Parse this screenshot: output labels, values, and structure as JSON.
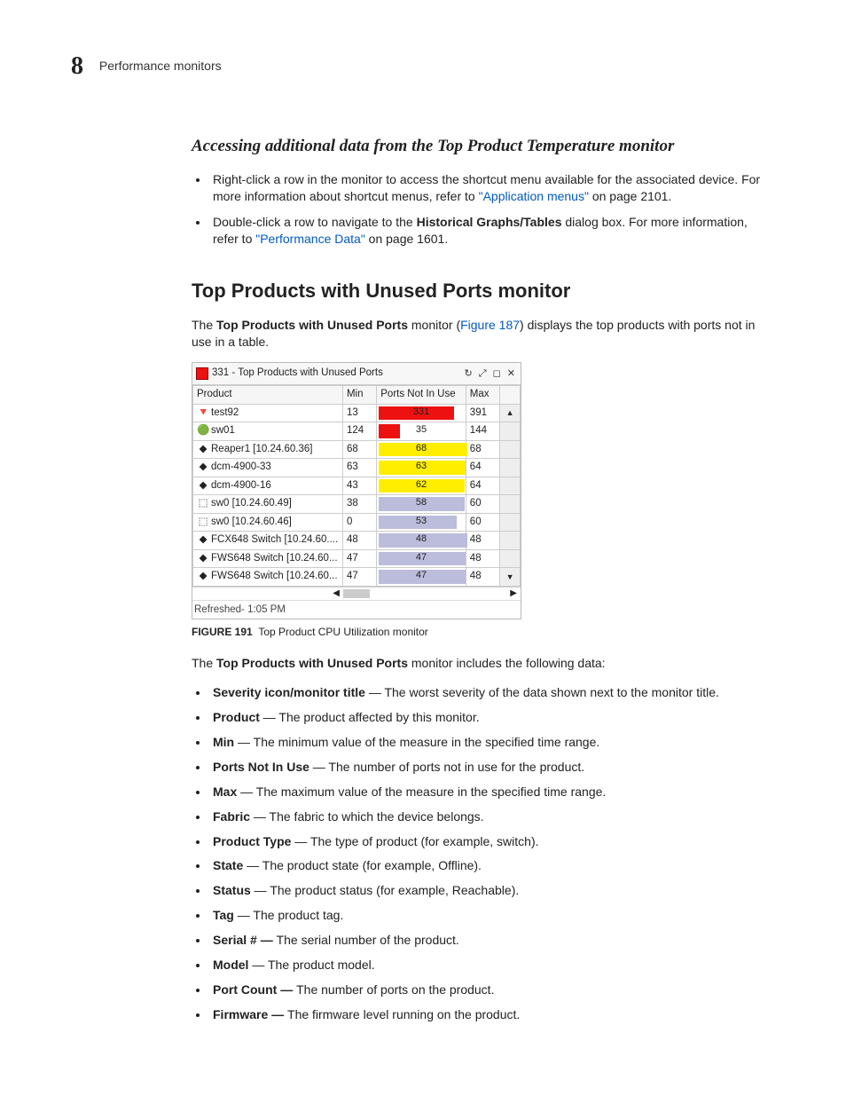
{
  "header": {
    "chapter": "8",
    "section": "Performance monitors"
  },
  "sub1": {
    "title": "Accessing additional data from the Top Product Temperature monitor",
    "bullets": [
      {
        "pre": "Right-click a row in the monitor to access the shortcut menu available for the associated device. For more information about shortcut menus, refer to ",
        "link": "\"Application menus\"",
        "post": " on page 2101."
      },
      {
        "pre": "Double-click a row to navigate to the ",
        "bold": "Historical Graphs/Tables",
        "mid": " dialog box. For more information, refer to ",
        "link": "\"Performance Data\"",
        "post": " on page 1601."
      }
    ]
  },
  "section2": {
    "title": "Top Products with Unused Ports monitor",
    "intro_pre": "The ",
    "intro_bold": "Top Products with Unused Ports",
    "intro_mid": " monitor (",
    "intro_link": "Figure 187",
    "intro_post": ") displays the top products with ports not in use in a table."
  },
  "figure": {
    "title": "331 - Top Products with Unused Ports",
    "columns": [
      "Product",
      "Min",
      "Ports Not In Use",
      "Max"
    ],
    "refreshed": "Refreshed- 1:05 PM",
    "caption_label": "FIGURE 191",
    "caption_text": "Top Product CPU Utilization monitor"
  },
  "chart_data": {
    "type": "table",
    "rows": [
      {
        "product": "test92",
        "min": 13,
        "ports": 331,
        "max": 391,
        "color": "#e11",
        "pct": 85,
        "icon": "🔻"
      },
      {
        "product": "sw01",
        "min": 124,
        "ports": 35,
        "max": 144,
        "color": "#e11",
        "pct": 24,
        "icon": "🟢"
      },
      {
        "product": "Reaper1 [10.24.60.36]",
        "min": 68,
        "ports": 68,
        "max": 68,
        "color": "#fe0",
        "pct": 100,
        "icon": "◆"
      },
      {
        "product": "dcm-4900-33",
        "min": 63,
        "ports": 63,
        "max": 64,
        "color": "#fe0",
        "pct": 98,
        "icon": "◆"
      },
      {
        "product": "dcm-4900-16",
        "min": 43,
        "ports": 62,
        "max": 64,
        "color": "#fe0",
        "pct": 97,
        "icon": "◆"
      },
      {
        "product": "sw0 [10.24.60.49]",
        "min": 38,
        "ports": 58,
        "max": 60,
        "color": "#bcbcdc",
        "pct": 97,
        "icon": "⬚"
      },
      {
        "product": "sw0 [10.24.60.46]",
        "min": 0,
        "ports": 53,
        "max": 60,
        "color": "#bcbcdc",
        "pct": 88,
        "icon": "⬚"
      },
      {
        "product": "FCX648 Switch [10.24.60....",
        "min": 48,
        "ports": 48,
        "max": 48,
        "color": "#bcbcdc",
        "pct": 100,
        "icon": "◆"
      },
      {
        "product": "FWS648 Switch [10.24.60...",
        "min": 47,
        "ports": 47,
        "max": 48,
        "color": "#bcbcdc",
        "pct": 98,
        "icon": "◆"
      },
      {
        "product": "FWS648 Switch [10.24.60...",
        "min": 47,
        "ports": 47,
        "max": 48,
        "color": "#bcbcdc",
        "pct": 98,
        "icon": "◆"
      }
    ]
  },
  "after_fig": {
    "intro_pre": "The ",
    "intro_bold": "Top Products with Unused Ports",
    "intro_post": " monitor includes the following data:",
    "items": [
      {
        "t": "Severity icon/monitor title",
        "d": " — The worst severity of the data shown next to the monitor title.",
        "boldDash": false
      },
      {
        "t": "Product",
        "d": " — The product affected by this monitor.",
        "boldDash": false
      },
      {
        "t": "Min",
        "d": " — The minimum value of the measure in the specified time range.",
        "boldDash": false
      },
      {
        "t": "Ports Not In Use",
        "d": " — The number of ports not in use for the product.",
        "boldDash": false
      },
      {
        "t": "Max",
        "d": " — The maximum value of the measure in the specified time range.",
        "boldDash": false
      },
      {
        "t": "Fabric",
        "d": " — The fabric to which the device belongs.",
        "boldDash": false
      },
      {
        "t": "Product Type",
        "d": " — The type of product (for example, switch).",
        "boldDash": false
      },
      {
        "t": "State",
        "d": " — The product state (for example, Offline).",
        "boldDash": false
      },
      {
        "t": "Status",
        "d": " — The product status (for example, Reachable).",
        "boldDash": false
      },
      {
        "t": "Tag",
        "d": " — The product tag.",
        "boldDash": false
      },
      {
        "t": "Serial #",
        "d": "The serial number of the product.",
        "boldDash": true
      },
      {
        "t": "Model",
        "d": " — The product model.",
        "boldDash": false
      },
      {
        "t": "Port Count",
        "d": "The number of ports on the product.",
        "boldDash": true
      },
      {
        "t": "Firmware",
        "d": "The firmware level running on the product.",
        "boldDash": true
      }
    ]
  }
}
